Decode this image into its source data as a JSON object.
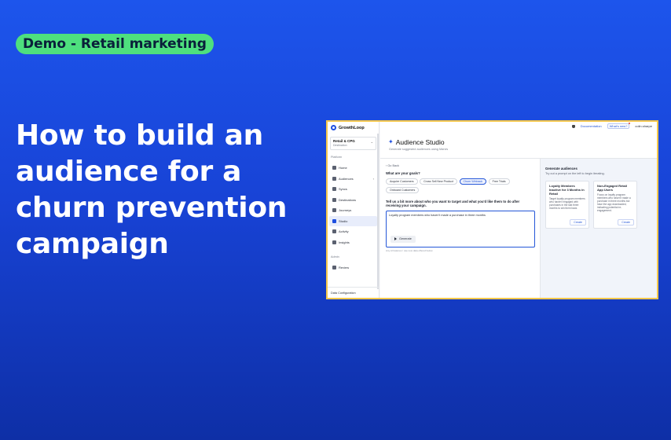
{
  "badge": {
    "text": "Demo - Retail marketing"
  },
  "headline": {
    "text": "How to build an audience for a churn prevention campaign"
  },
  "app": {
    "brand": "GrowthLoop",
    "workspace": {
      "title": "Retail & CPG",
      "subtitle": "Destination"
    },
    "sections": {
      "platform": "Platform",
      "admin": "Admin"
    },
    "nav": [
      {
        "label": "Home",
        "icon": "home-icon"
      },
      {
        "label": "Audiences",
        "icon": "people-icon"
      },
      {
        "label": "Syncs",
        "icon": "sync-icon"
      },
      {
        "label": "Destinations",
        "icon": "destination-icon"
      },
      {
        "label": "Journeys",
        "icon": "journey-icon"
      },
      {
        "label": "Studio",
        "icon": "sparkle-icon"
      },
      {
        "label": "Activity",
        "icon": "activity-icon"
      },
      {
        "label": "Insights",
        "icon": "insights-icon"
      }
    ],
    "admin_nav": [
      {
        "label": "Review",
        "icon": "review-icon"
      }
    ],
    "bottom": "Data Configuration",
    "topbar": {
      "documentation": "Documentation",
      "whats_new": "What's new?",
      "user": "colin.sharpe"
    },
    "page": {
      "title": "Audience Studio",
      "subtitle": "Generate suggested audiences using Marvis",
      "back": "Go Back",
      "goals_question": "What are your goals?",
      "goals": [
        "Acquire Customers",
        "Cross Sell New Product",
        "Churn Winback",
        "Free Trials",
        "Onboard Customers"
      ],
      "selected_goal": "Churn Winback",
      "tell_prompt": "Tell us a bit more about who you want to target and what you'd like them to do after receiving your campaign.",
      "prompt_value": "Loyalty program members who haven't made a purchase in three months",
      "generate_label": "Generate",
      "hint": "Any AI features / use new data offered below"
    },
    "generate": {
      "title": "Generate audiences",
      "subtitle": "Try out a prompt on the left to begin iterating.",
      "cards": [
        {
          "title": "Loyalty Members Inactive for 3 Months in Retail",
          "desc": "Target loyalty program members who haven't engaged with purchases in the last three months to win them back.",
          "button": "Create"
        },
        {
          "title": "Non-Engaged Retail App Users",
          "desc": "Focus on loyalty program members who haven't made a purchase in three months but have the app downloaded, indicating potential re-engagement.",
          "button": "Create"
        }
      ]
    }
  },
  "colors": {
    "accent": "#1e4fe0",
    "badge": "#4ee07e",
    "frame": "#f5c84c"
  }
}
